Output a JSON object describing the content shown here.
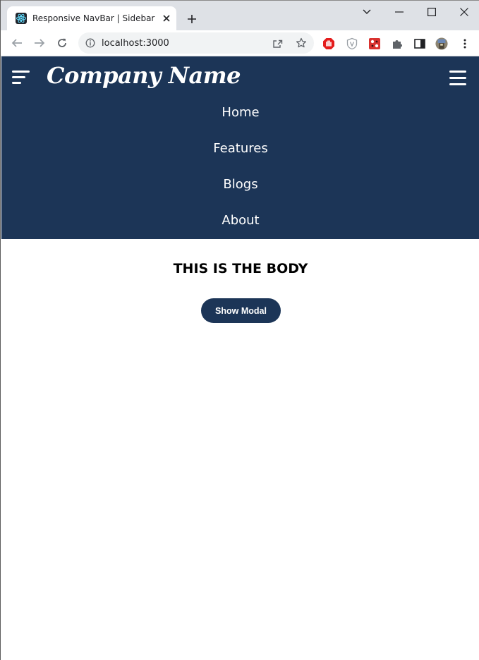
{
  "browser": {
    "tab_title": "Responsive NavBar | Sidebar",
    "url": "localhost:3000"
  },
  "colors": {
    "header_bg": "#1c3557",
    "button_bg": "#1c3557",
    "tab_strip_bg": "#dee1e6"
  },
  "header": {
    "brand": "Company Name",
    "nav_links": [
      "Home",
      "Features",
      "Blogs",
      "About"
    ]
  },
  "main": {
    "title": "THIS IS THE BODY",
    "button_label": "Show Modal"
  },
  "icons": [
    "react-icon",
    "close-icon",
    "plus-icon",
    "chevron-down-icon",
    "minimize-icon",
    "maximize-icon",
    "back-icon",
    "forward-icon",
    "reload-icon",
    "info-icon",
    "share-icon",
    "star-icon",
    "adblock-icon",
    "shield-icon",
    "extension-icon",
    "puzzle-icon",
    "sidepanel-icon",
    "profile-icon",
    "more-icon",
    "sidebar-toggle-icon",
    "hamburger-icon"
  ]
}
